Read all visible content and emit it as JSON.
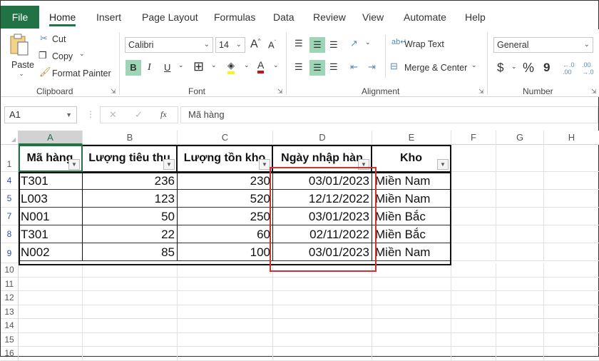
{
  "ribbon_tabs": [
    "File",
    "Home",
    "Insert",
    "Page Layout",
    "Formulas",
    "Data",
    "Review",
    "View",
    "Automate",
    "Help"
  ],
  "active_tab": "Home",
  "clipboard": {
    "paste": "Paste",
    "cut": "Cut",
    "copy": "Copy",
    "format_painter": "Format Painter",
    "label": "Clipboard"
  },
  "font": {
    "name": "Calibri",
    "size": "14",
    "bold": "B",
    "italic": "I",
    "underline": "U",
    "label": "Font"
  },
  "alignment": {
    "wrap_text": "Wrap Text",
    "merge_center": "Merge & Center",
    "label": "Alignment"
  },
  "number": {
    "format": "General",
    "currency": "$",
    "percent": "%",
    "comma": "9",
    "label": "Number"
  },
  "formula_bar": {
    "name_box": "A1",
    "fx": "fx",
    "cancel": "✕",
    "enter": "✓",
    "content": "Mã hàng"
  },
  "columns": [
    "A",
    "B",
    "C",
    "D",
    "E",
    "F",
    "G",
    "H"
  ],
  "row_numbers": [
    "1",
    "4",
    "5",
    "7",
    "8",
    "9",
    "10",
    "11",
    "12",
    "13",
    "14",
    "15",
    "16"
  ],
  "table": {
    "headers": [
      "Mã hàng",
      "Lượng tiêu thụ",
      "Lượng tồn kho",
      "Ngày nhập hàng",
      "Kho"
    ],
    "header_display": [
      "Mã hàng",
      "Lượng tiêu thụ",
      "Lượng tồn kho",
      "Ngày nhập hàn",
      "Kho"
    ],
    "rows": [
      [
        "T301",
        "236",
        "230",
        "03/01/2023",
        "Miền Nam"
      ],
      [
        "L003",
        "123",
        "520",
        "12/12/2022",
        "Miền Nam"
      ],
      [
        "N001",
        "50",
        "250",
        "03/01/2023",
        "Miền Bắc"
      ],
      [
        "T301",
        "22",
        "60",
        "02/11/2022",
        "Miền Bắc"
      ],
      [
        "N002",
        "85",
        "100",
        "03/01/2023",
        "Miền Nam"
      ]
    ]
  },
  "colors": {
    "excel_green": "#217346",
    "highlight": "#d03030"
  }
}
